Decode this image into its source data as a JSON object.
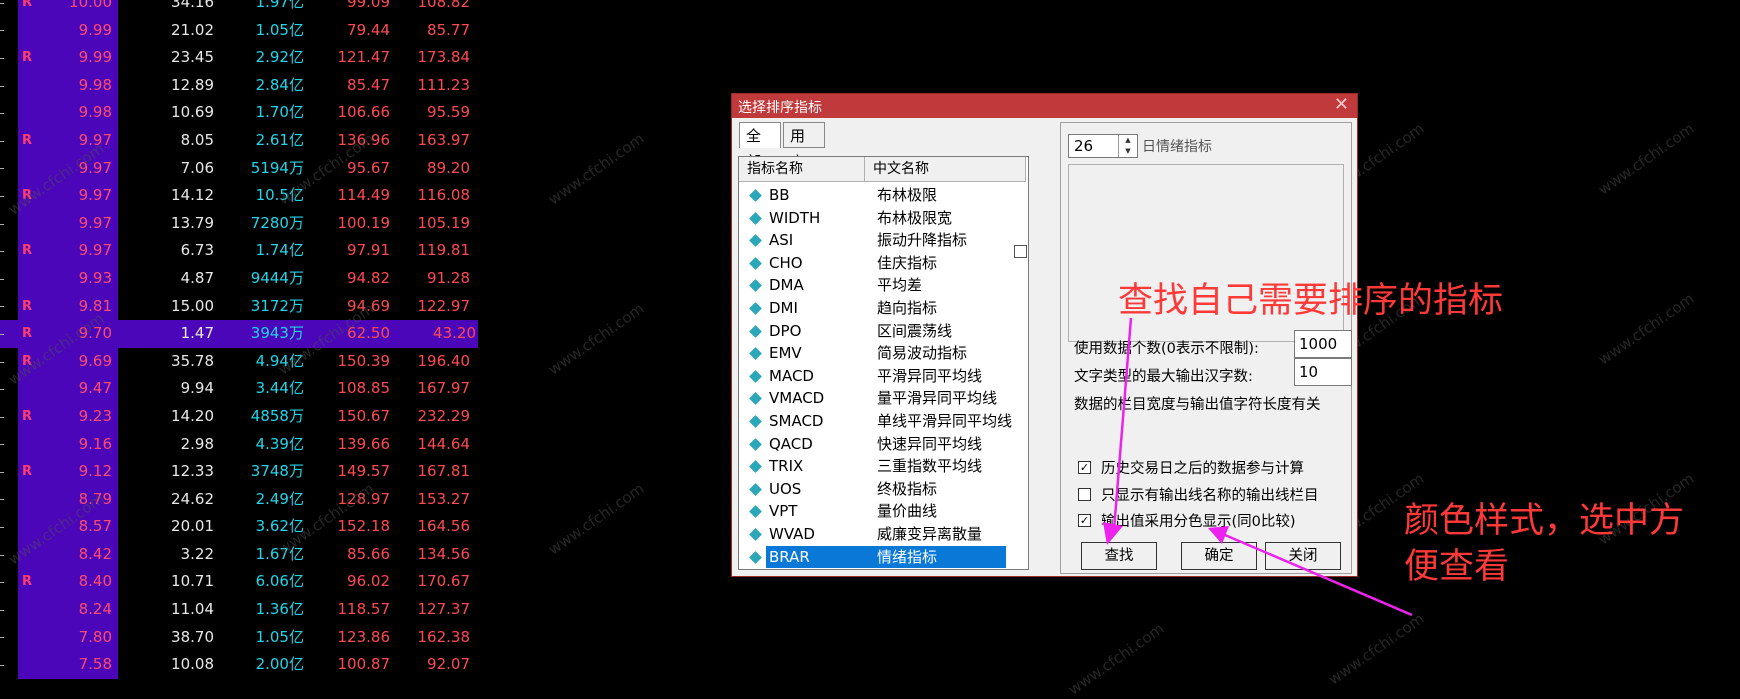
{
  "stock_table": {
    "rows": [
      {
        "r": "R",
        "rate": "10.00",
        "chg": "34.16",
        "amt_num": "1.97",
        "amt_unit": "亿",
        "v1": "99.09",
        "v2": "108.82",
        "hl": false
      },
      {
        "r": "",
        "rate": "9.99",
        "chg": "21.02",
        "amt_num": "1.05",
        "amt_unit": "亿",
        "v1": "79.44",
        "v2": "85.77",
        "hl": false
      },
      {
        "r": "R",
        "rate": "9.99",
        "chg": "23.45",
        "amt_num": "2.92",
        "amt_unit": "亿",
        "v1": "121.47",
        "v2": "173.84",
        "hl": false
      },
      {
        "r": "",
        "rate": "9.98",
        "chg": "12.89",
        "amt_num": "2.84",
        "amt_unit": "亿",
        "v1": "85.47",
        "v2": "111.23",
        "hl": false
      },
      {
        "r": "",
        "rate": "9.98",
        "chg": "10.69",
        "amt_num": "1.70",
        "amt_unit": "亿",
        "v1": "106.66",
        "v2": "95.59",
        "hl": false
      },
      {
        "r": "R",
        "rate": "9.97",
        "chg": "8.05",
        "amt_num": "2.61",
        "amt_unit": "亿",
        "v1": "136.96",
        "v2": "163.97",
        "hl": false
      },
      {
        "r": "",
        "rate": "9.97",
        "chg": "7.06",
        "amt_num": "5194",
        "amt_unit": "万",
        "v1": "95.67",
        "v2": "89.20",
        "hl": false
      },
      {
        "r": "R",
        "rate": "9.97",
        "chg": "14.12",
        "amt_num": "10.5",
        "amt_unit": "亿",
        "v1": "114.49",
        "v2": "116.08",
        "hl": false
      },
      {
        "r": "",
        "rate": "9.97",
        "chg": "13.79",
        "amt_num": "7280",
        "amt_unit": "万",
        "v1": "100.19",
        "v2": "105.19",
        "hl": false
      },
      {
        "r": "R",
        "rate": "9.97",
        "chg": "6.73",
        "amt_num": "1.74",
        "amt_unit": "亿",
        "v1": "97.91",
        "v2": "119.81",
        "hl": false
      },
      {
        "r": "",
        "rate": "9.93",
        "chg": "4.87",
        "amt_num": "9444",
        "amt_unit": "万",
        "v1": "94.82",
        "v2": "91.28",
        "hl": false
      },
      {
        "r": "R",
        "rate": "9.81",
        "chg": "15.00",
        "amt_num": "3172",
        "amt_unit": "万",
        "v1": "94.69",
        "v2": "122.97",
        "hl": false
      },
      {
        "r": "R",
        "rate": "9.70",
        "chg": "1.47",
        "amt_num": "3943",
        "amt_unit": "万",
        "v1": "62.50",
        "v2": "43.20",
        "hl": true
      },
      {
        "r": "R",
        "rate": "9.69",
        "chg": "35.78",
        "amt_num": "4.94",
        "amt_unit": "亿",
        "v1": "150.39",
        "v2": "196.40",
        "hl": false
      },
      {
        "r": "",
        "rate": "9.47",
        "chg": "9.94",
        "amt_num": "3.44",
        "amt_unit": "亿",
        "v1": "108.85",
        "v2": "167.97",
        "hl": false
      },
      {
        "r": "R",
        "rate": "9.23",
        "chg": "14.20",
        "amt_num": "4858",
        "amt_unit": "万",
        "v1": "150.67",
        "v2": "232.29",
        "hl": false
      },
      {
        "r": "",
        "rate": "9.16",
        "chg": "2.98",
        "amt_num": "4.39",
        "amt_unit": "亿",
        "v1": "139.66",
        "v2": "144.64",
        "hl": false
      },
      {
        "r": "R",
        "rate": "9.12",
        "chg": "12.33",
        "amt_num": "3748",
        "amt_unit": "万",
        "v1": "149.57",
        "v2": "167.81",
        "hl": false
      },
      {
        "r": "",
        "rate": "8.79",
        "chg": "24.62",
        "amt_num": "2.49",
        "amt_unit": "亿",
        "v1": "128.97",
        "v2": "153.27",
        "hl": false
      },
      {
        "r": "",
        "rate": "8.57",
        "chg": "20.01",
        "amt_num": "3.62",
        "amt_unit": "亿",
        "v1": "152.18",
        "v2": "164.56",
        "hl": false
      },
      {
        "r": "",
        "rate": "8.42",
        "chg": "3.22",
        "amt_num": "1.67",
        "amt_unit": "亿",
        "v1": "85.66",
        "v2": "134.56",
        "hl": false
      },
      {
        "r": "R",
        "rate": "8.40",
        "chg": "10.71",
        "amt_num": "6.06",
        "amt_unit": "亿",
        "v1": "96.02",
        "v2": "170.67",
        "hl": false
      },
      {
        "r": "",
        "rate": "8.24",
        "chg": "11.04",
        "amt_num": "1.36",
        "amt_unit": "亿",
        "v1": "118.57",
        "v2": "127.37",
        "hl": false
      },
      {
        "r": "",
        "rate": "7.80",
        "chg": "38.70",
        "amt_num": "1.05",
        "amt_unit": "亿",
        "v1": "123.86",
        "v2": "162.38",
        "hl": false
      },
      {
        "r": "",
        "rate": "7.58",
        "chg": "10.08",
        "amt_num": "2.00",
        "amt_unit": "亿",
        "v1": "100.87",
        "v2": "92.07",
        "hl": false
      }
    ]
  },
  "watermark": "www.cfchi.com",
  "dialog": {
    "title": "选择排序指标",
    "close_icon": "✕",
    "tabs": {
      "all": "全部",
      "user": "用户"
    },
    "list_headers": {
      "code": "指标名称",
      "name": "中文名称"
    },
    "items": [
      {
        "code": "BB",
        "name": "布林极限"
      },
      {
        "code": "WIDTH",
        "name": "布林极限宽"
      },
      {
        "code": "ASI",
        "name": "振动升降指标"
      },
      {
        "code": "CHO",
        "name": "佳庆指标"
      },
      {
        "code": "DMA",
        "name": "平均差"
      },
      {
        "code": "DMI",
        "name": "趋向指标"
      },
      {
        "code": "DPO",
        "name": "区间震荡线"
      },
      {
        "code": "EMV",
        "name": "简易波动指标"
      },
      {
        "code": "MACD",
        "name": "平滑异同平均线"
      },
      {
        "code": "VMACD",
        "name": "量平滑异同平均线"
      },
      {
        "code": "SMACD",
        "name": "单线平滑异同平均线"
      },
      {
        "code": "QACD",
        "name": "快速异同平均线"
      },
      {
        "code": "TRIX",
        "name": "三重指数平均线"
      },
      {
        "code": "UOS",
        "name": "终极指标"
      },
      {
        "code": "VPT",
        "name": "量价曲线"
      },
      {
        "code": "WVAD",
        "name": "威廉变异离散量"
      },
      {
        "code": "BRAR",
        "name": "情绪指标"
      }
    ],
    "selected_index": 16,
    "spin_value": "26",
    "spin_label": "日情绪指标",
    "data_count_label": "使用数据个数(0表示不限制):",
    "data_count_value": "1000",
    "max_chars_label": "文字类型的最大输出汉字数:",
    "max_chars_value": "10",
    "width_note": "数据的栏目宽度与输出值字符长度有关",
    "check1_label": "历史交易日之后的数据参与计算",
    "check1_checked": "✓",
    "check2_label": "只显示有输出线名称的输出线栏目",
    "check2_checked": "",
    "check3_label": "输出值采用分色显示(同0比较)",
    "check3_checked": "✓",
    "buttons": {
      "find": "查找",
      "ok": "确定",
      "close": "关闭"
    }
  },
  "annotations": {
    "find_note": "查找自己需要排序的指标",
    "color_note_line1": "颜色样式，选中方",
    "color_note_line2": "便查看"
  },
  "colors": {
    "highlight": "#4a06b8",
    "annotation": "#ff3838",
    "arrow": "#ee22ee",
    "selection": "#0a78d7"
  }
}
